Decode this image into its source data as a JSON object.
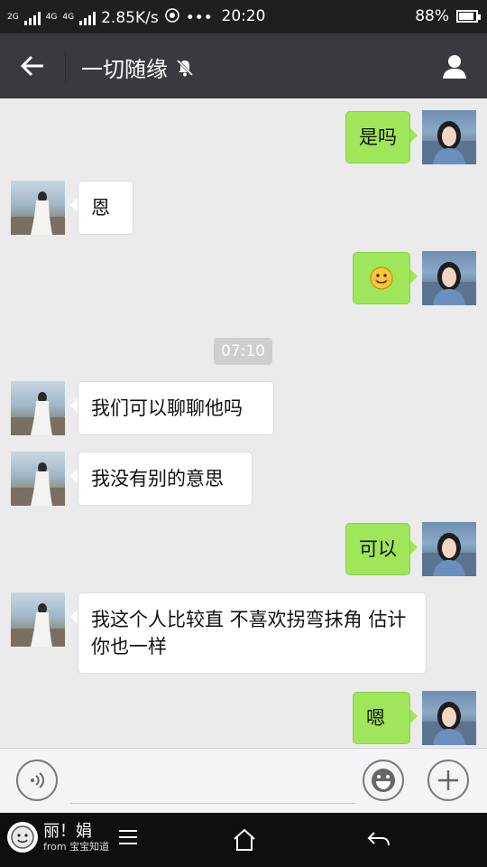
{
  "status_bar": {
    "network": "2G",
    "network2": "4G",
    "network3": "4G",
    "speed": "2.85K/s",
    "time": "20:20",
    "battery": "88%",
    "battery_level": 0.88
  },
  "header": {
    "title": "一切随缘",
    "back_icon": "back-arrow-icon",
    "mute_icon": "bell-muted-icon",
    "profile_icon": "person-icon"
  },
  "messages": [
    {
      "side": "self",
      "text": "是吗"
    },
    {
      "side": "other",
      "text": "恩"
    },
    {
      "side": "self",
      "text": "🙂",
      "kind": "emoji"
    },
    {
      "side": "time",
      "text": "07:10"
    },
    {
      "side": "other",
      "text": "我们可以聊聊他吗"
    },
    {
      "side": "other",
      "text": "我没有别的意思"
    },
    {
      "side": "self",
      "text": "可以"
    },
    {
      "side": "other",
      "text": "我这个人比较直 不喜欢拐弯抹角 估计你也一样"
    },
    {
      "side": "self",
      "text": "嗯"
    }
  ],
  "input_bar": {
    "voice_icon": "voice-icon",
    "emoji_icon": "emoji-icon",
    "plus_icon": "plus-icon",
    "value": ""
  },
  "watermark": {
    "name": "丽！娟",
    "source": "from 宝宝知道"
  },
  "colors": {
    "self_bubble": "#9fe65a",
    "other_bubble": "#ffffff",
    "header": "#393a3f",
    "background": "#ebebeb"
  }
}
